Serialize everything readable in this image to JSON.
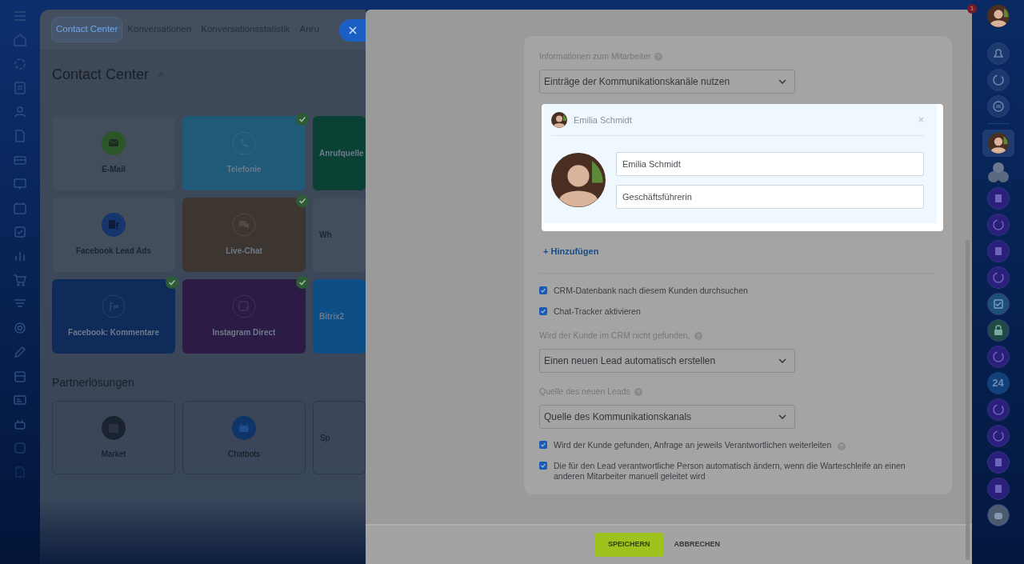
{
  "right_sidebar": {
    "notification_count": "1",
    "app_label": "24"
  },
  "background_window": {
    "tabs": [
      {
        "label": "Contact Center",
        "selected": true
      },
      {
        "label": "Konversationen",
        "selected": false
      },
      {
        "label": "Konversationsstatistik",
        "selected": false
      },
      {
        "label": "Anru",
        "selected": false
      }
    ],
    "title": "Contact Center",
    "tiles": [
      {
        "label": "E-Mail",
        "kind": "plain",
        "color": "#434d5c",
        "connected": false
      },
      {
        "label": "Telefonie",
        "kind": "colored",
        "color": "#1f5a78",
        "connected": true
      },
      {
        "label": "Anrufquelle",
        "kind": "colored",
        "color": "#0b4134",
        "connected": false
      },
      {
        "label": "Facebook Lead Ads",
        "kind": "plain",
        "color": "#434d5c",
        "connected": false
      },
      {
        "label": "Live-Chat",
        "kind": "colored",
        "color": "#3c3530",
        "connected": true
      },
      {
        "label": "Wh",
        "kind": "plain",
        "color": "#434d5c",
        "connected": false
      },
      {
        "label": "Facebook: Kommentare",
        "kind": "colored",
        "color": "#0e2b5a",
        "connected": true
      },
      {
        "label": "Instagram Direct",
        "kind": "colored",
        "color": "#2c1c45",
        "connected": true
      },
      {
        "label": "Bitrix2",
        "kind": "colored",
        "color": "#0c4e85",
        "connected": false
      }
    ],
    "section_title": "Partnerlösungen",
    "partner_tiles": [
      {
        "label": "Market"
      },
      {
        "label": "Chatbots"
      },
      {
        "label": "Sp"
      }
    ]
  },
  "form": {
    "items": [
      {
        "kind": "label",
        "text": "Informationen zum Mitarbeiter",
        "help": true
      },
      {
        "kind": "select",
        "value": "Einträge der Kommunikationskanäle nutzen"
      },
      {
        "kind": "employee_card",
        "header_name": "Emilia Schmidt",
        "name_value": "Emilia Schmidt",
        "position_value": "Geschäftsführerin"
      },
      {
        "kind": "link",
        "text": "+ Hinzufügen"
      },
      {
        "kind": "divider"
      },
      {
        "kind": "checkbox",
        "text": "CRM-Datenbank nach diesem Kunden durchsuchen",
        "checked": true,
        "help": false
      },
      {
        "kind": "checkbox",
        "text": "Chat-Tracker aktivieren",
        "checked": true,
        "help": false
      },
      {
        "kind": "label",
        "text": "Wird der Kunde im CRM nicht gefunden,",
        "help": true
      },
      {
        "kind": "select",
        "value": "Einen neuen Lead automatisch erstellen"
      },
      {
        "kind": "label",
        "text": "Quelle des neuen Leads",
        "help": true
      },
      {
        "kind": "select",
        "value": "Quelle des Kommunikationskanals"
      },
      {
        "kind": "checkbox",
        "text": "Wird der Kunde gefunden, Anfrage an jeweils Verantwortlichen weiterleiten",
        "checked": true,
        "help": true
      },
      {
        "kind": "checkbox",
        "text": "Die für den Lead verantwortliche Person automatisch ändern, wenn die Warteschleife an einen anderen Mitarbeiter manuell geleitet wird",
        "checked": true,
        "help": false
      }
    ]
  },
  "footer": {
    "buttons": [
      {
        "label": "SPEICHERN",
        "kind": "primary"
      },
      {
        "label": "ABBRECHEN",
        "kind": "link"
      }
    ]
  }
}
